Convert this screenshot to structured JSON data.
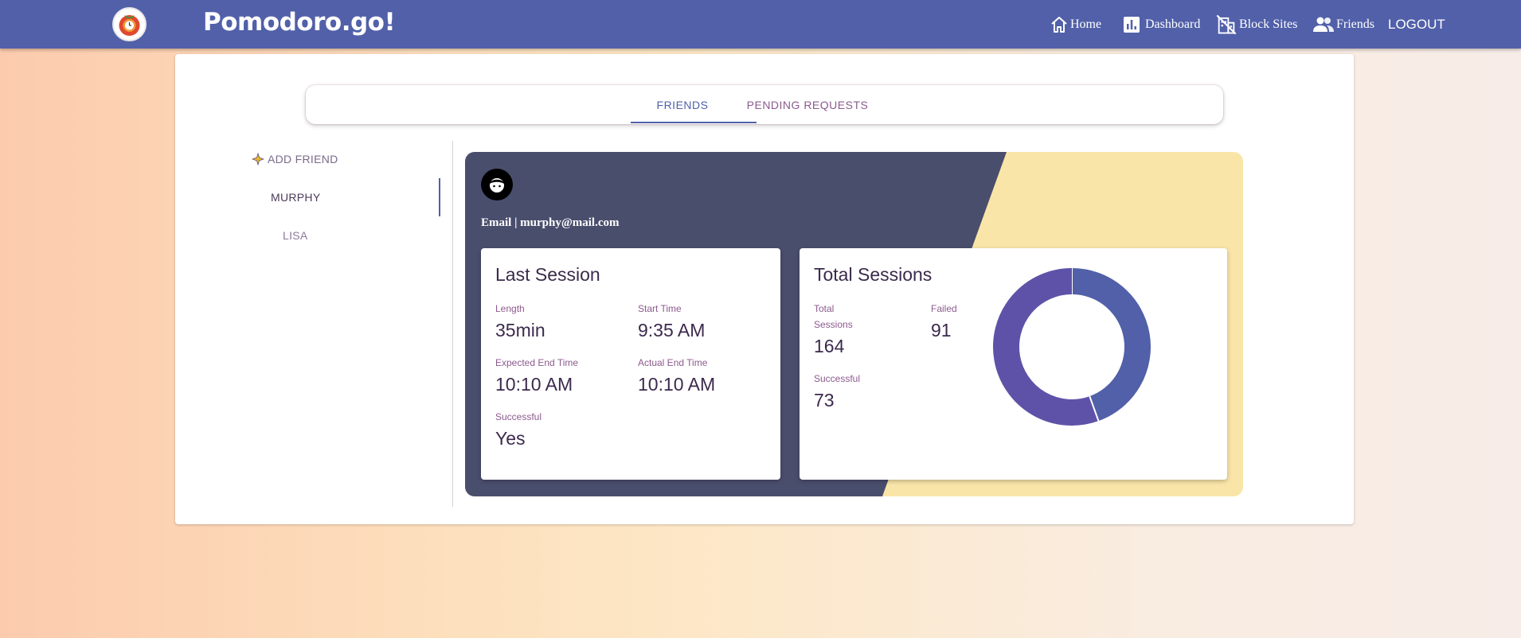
{
  "app": {
    "brand": "Pomodoro.go!"
  },
  "nav": {
    "home": "Home",
    "dashboard": "Dashboard",
    "block_sites": "Block Sites",
    "friends": "Friends",
    "logout": "LOGOUT"
  },
  "tabs": {
    "friends": "FRIENDS",
    "pending": "PENDING REQUESTS"
  },
  "sidebar": {
    "add_friend": "ADD FRIEND",
    "friends": [
      "MURPHY",
      "LISA"
    ]
  },
  "profile": {
    "email_line": "Email | murphy@mail.com"
  },
  "last_session": {
    "title": "Last Session",
    "length_label": "Length",
    "length_value": "35min",
    "start_label": "Start Time",
    "start_value": "9:35 AM",
    "expected_end_label": "Expected End Time",
    "expected_end_value": "10:10 AM",
    "actual_end_label": "Actual End Time",
    "actual_end_value": "10:10 AM",
    "successful_label": "Successful",
    "successful_value": "Yes"
  },
  "total_sessions": {
    "title": "Total Sessions",
    "total_label_line1": "Total",
    "total_label_line2": "Sessions",
    "total_value": "164",
    "failed_label": "Failed",
    "failed_value": "91",
    "successful_label": "Successful",
    "successful_value": "73"
  },
  "colors": {
    "accent": "#5160a9",
    "panel_dark": "#4a4e6d",
    "panel_yellow": "#fae5a9",
    "donut_successful": "#5160a9",
    "donut_failed": "#5e52a8"
  }
}
